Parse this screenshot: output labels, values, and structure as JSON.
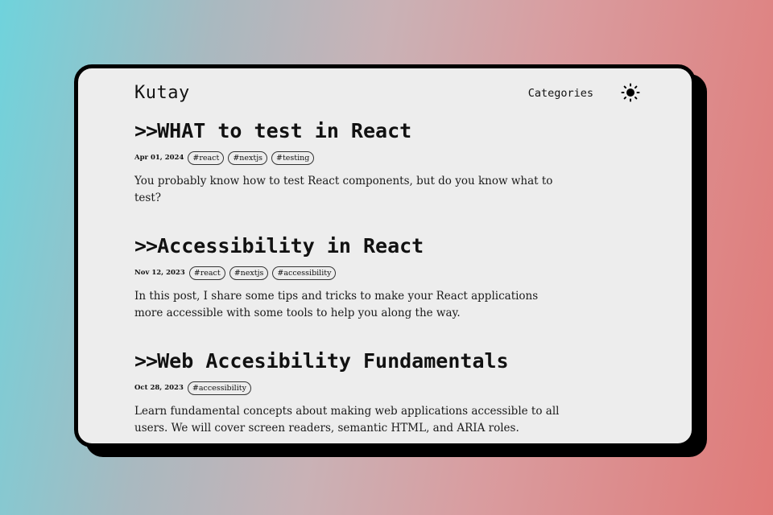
{
  "header": {
    "logo": "Kutay",
    "nav_categories": "Categories",
    "theme_icon": "sun-icon"
  },
  "posts": [
    {
      "prefix": ">>",
      "title": "WHAT to test in React",
      "date": "Apr 01, 2024",
      "tags": [
        "#react",
        "#nextjs",
        "#testing"
      ],
      "excerpt": "You probably know how to test React components, but do you know what to test?"
    },
    {
      "prefix": ">>",
      "title": "Accessibility in React",
      "date": "Nov 12, 2023",
      "tags": [
        "#react",
        "#nextjs",
        "#accessibility"
      ],
      "excerpt": "In this post, I share some tips and tricks to make your React applications more accessible with some tools to help you along the way."
    },
    {
      "prefix": ">>",
      "title": "Web Accesibility Fundamentals",
      "date": "Oct 28, 2023",
      "tags": [
        "#accessibility"
      ],
      "excerpt": "Learn fundamental concepts about making web applications accessible to all users. We will cover screen readers, semantic HTML, and ARIA roles."
    }
  ]
}
